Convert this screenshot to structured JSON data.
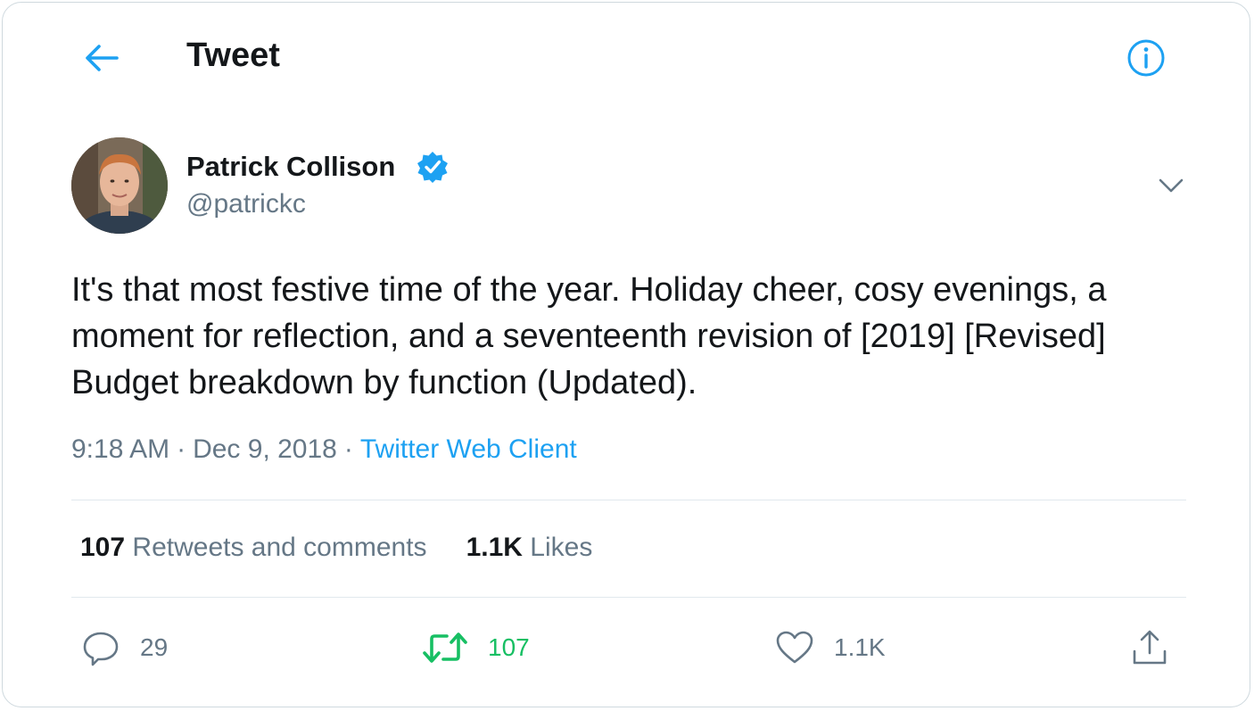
{
  "header": {
    "title": "Tweet"
  },
  "author": {
    "name": "Patrick Collison",
    "handle": "@patrickc"
  },
  "tweet": {
    "text": "It's that most festive time of the year. Holiday cheer, cosy evenings, a moment for reflection, and a seventeenth revision of [2019] [Revised] Budget breakdown by function (Updated).",
    "time": "9:18 AM",
    "date": "Dec 9, 2018",
    "separator": "·",
    "source": "Twitter Web Client"
  },
  "stats": {
    "retweets_count": "107",
    "retweets_label": "Retweets and comments",
    "likes_count": "1.1K",
    "likes_label": "Likes"
  },
  "actions": {
    "reply_count": "29",
    "retweet_count": "107",
    "like_count": "1.1K"
  },
  "colors": {
    "accent": "#1da1f2",
    "retweet_green": "#17bf63",
    "secondary_text": "#657786",
    "primary_text": "#14171a",
    "divider": "#e1e8ed"
  },
  "icons": {
    "back": "arrow-left-icon",
    "info": "info-icon",
    "verified": "verified-badge-icon",
    "more": "chevron-down-icon",
    "reply": "reply-icon",
    "retweet": "retweet-icon",
    "like": "heart-icon",
    "share": "share-icon"
  }
}
